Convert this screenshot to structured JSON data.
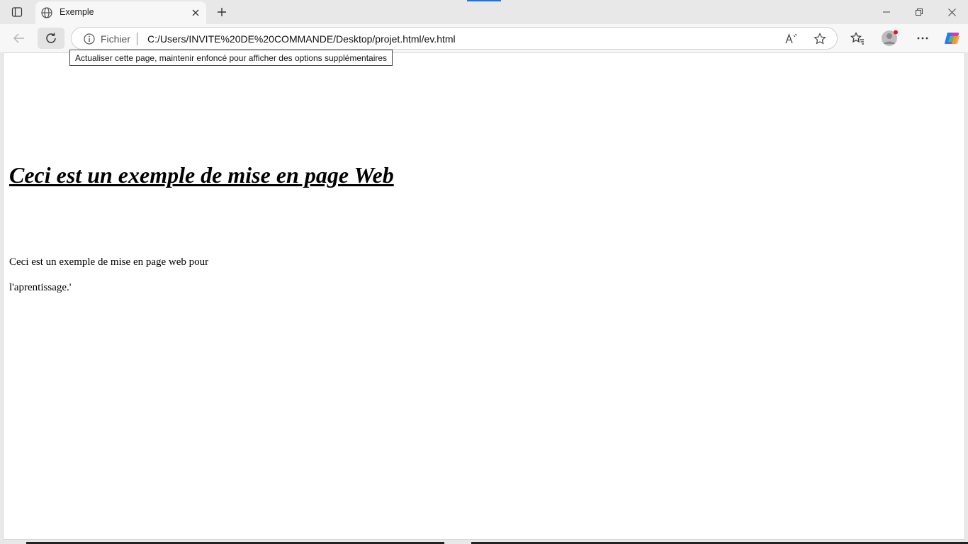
{
  "browser": {
    "tab": {
      "title": "Exemple"
    },
    "address_bar": {
      "scheme_label": "Fichier",
      "url": "C:/Users/INVITE%20DE%20COMMANDE/Desktop/projet.html/ev.html"
    },
    "tooltip": "Actualiser cette page, maintenir enfoncé pour afficher des options supplémentaires",
    "icons": {
      "tab_actions": "tab-actions-icon",
      "tab": "globe-icon",
      "tab_close": "close-icon",
      "new_tab": "plus-icon",
      "back": "arrow-left-icon",
      "refresh": "refresh-icon",
      "site_info": "info-icon",
      "read_aloud": "read-aloud-icon",
      "favorite": "star-icon",
      "favorites": "favorites-icon",
      "profile": "avatar-icon",
      "more": "more-icon",
      "copilot": "copilot-icon",
      "minimize": "minimize-icon",
      "restore": "restore-icon",
      "close_window": "close-icon"
    },
    "colors": {
      "chrome": "#e8e8e8",
      "accent": "#1a73e8",
      "notification_dot": "#e81123"
    }
  },
  "page": {
    "heading": "Ceci est un exemple de mise en page Web",
    "paragraph_line1": "Ceci est un exemple de mise en page web pour",
    "paragraph_line2": "l'aprentissage.'"
  }
}
